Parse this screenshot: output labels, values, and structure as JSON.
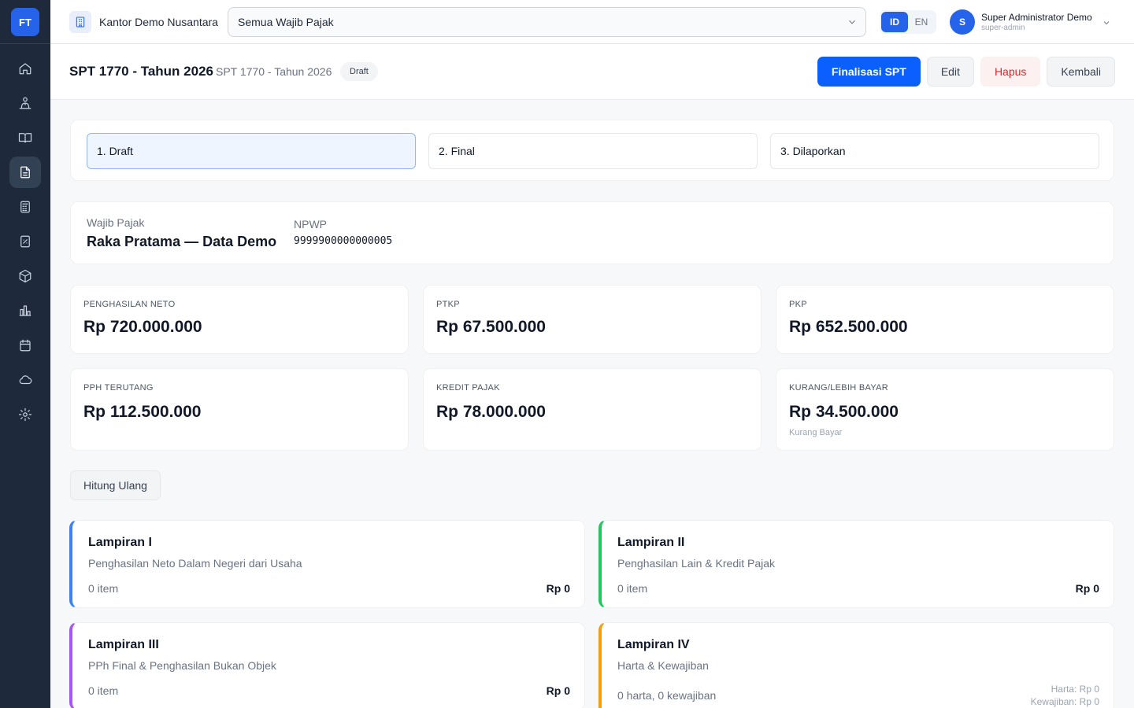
{
  "app": {
    "logo": "FT"
  },
  "sidebar": {
    "items": [
      {
        "name": "home-icon",
        "active": false
      },
      {
        "name": "organization-icon",
        "active": false
      },
      {
        "name": "book-icon",
        "active": false
      },
      {
        "name": "document-icon",
        "active": true
      },
      {
        "name": "calculator-icon",
        "active": false
      },
      {
        "name": "receipt-icon",
        "active": false
      },
      {
        "name": "box-icon",
        "active": false
      },
      {
        "name": "bar-chart-icon",
        "active": false
      },
      {
        "name": "calendar-icon",
        "active": false
      },
      {
        "name": "cloud-icon",
        "active": false
      },
      {
        "name": "gear-icon",
        "active": false
      }
    ]
  },
  "topbar": {
    "office": "Kantor Demo Nusantara",
    "taxpayer_select": "Semua Wajib Pajak",
    "lang": [
      "ID",
      "EN"
    ],
    "lang_active": "ID",
    "user": {
      "initial": "S",
      "name": "Super Administrator Demo",
      "role": "super-admin"
    }
  },
  "header": {
    "title": "SPT 1770 - Tahun 2026",
    "subtitle": "SPT 1770 - Tahun 2026",
    "badge": "Draft",
    "actions": {
      "finalize": "Finalisasi SPT",
      "edit": "Edit",
      "delete": "Hapus",
      "back": "Kembali"
    }
  },
  "steps": [
    "1. Draft",
    "2. Final",
    "3. Dilaporkan"
  ],
  "taxpayer": {
    "label": "Wajib Pajak",
    "name": "Raka Pratama — Data Demo",
    "npwp_label": "NPWP",
    "npwp": "9999900000000005"
  },
  "metrics": [
    {
      "label": "Penghasilan Neto",
      "value": "Rp 720.000.000",
      "note": ""
    },
    {
      "label": "PTKP",
      "value": "Rp 67.500.000",
      "note": ""
    },
    {
      "label": "PKP",
      "value": "Rp 652.500.000",
      "note": ""
    },
    {
      "label": "PPh Terutang",
      "value": "Rp 112.500.000",
      "note": ""
    },
    {
      "label": "Kredit Pajak",
      "value": "Rp 78.000.000",
      "note": ""
    },
    {
      "label": "Kurang/Lebih Bayar",
      "value": "Rp 34.500.000",
      "note": "Kurang Bayar"
    }
  ],
  "recalculate": "Hitung Ulang",
  "attachments": [
    {
      "title": "Lampiran I",
      "desc": "Penghasilan Neto Dalam Negeri dari Usaha",
      "count": "0 item",
      "total": "Rp 0",
      "color": "#3b82f6"
    },
    {
      "title": "Lampiran II",
      "desc": "Penghasilan Lain & Kredit Pajak",
      "count": "0 item",
      "total": "Rp 0",
      "color": "#22c55e"
    },
    {
      "title": "Lampiran III",
      "desc": "PPh Final & Penghasilan Bukan Objek",
      "count": "0 item",
      "total": "Rp 0",
      "color": "#a855f7"
    },
    {
      "title": "Lampiran IV",
      "desc": "Harta & Kewajiban",
      "count": "0 harta, 0 kewajiban",
      "assets": "Harta: Rp 0",
      "liabilities": "Kewajiban: Rp 0",
      "color": "#f59e0b"
    }
  ]
}
